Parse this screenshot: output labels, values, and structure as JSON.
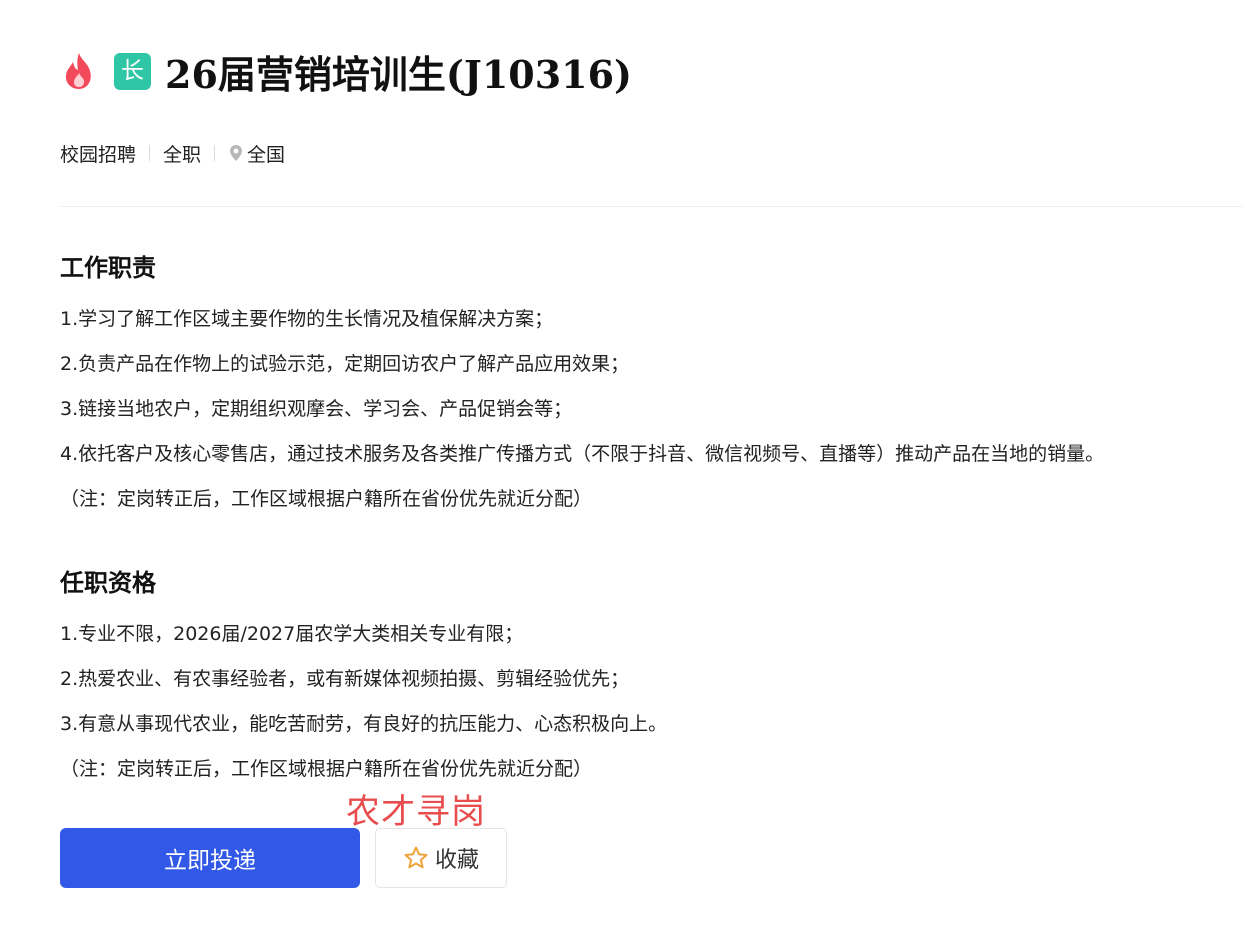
{
  "header": {
    "hot_icon": "fire-icon",
    "badge_text": "长",
    "badge_color": "#2ec6a4",
    "title": "26届营销培训生(J10316)"
  },
  "meta": {
    "recruit_type": "校园招聘",
    "job_type": "全职",
    "location_icon": "map-pin-icon",
    "location": "全国"
  },
  "duties": {
    "title": "工作职责",
    "lines": [
      "1.学习了解工作区域主要作物的生长情况及植保解决方案；",
      "2.负责产品在作物上的试验示范，定期回访农户了解产品应用效果；",
      "3.链接当地农户，定期组织观摩会、学习会、产品促销会等；",
      "4.依托客户及核心零售店，通过技术服务及各类推广传播方式（不限于抖音、微信视频号、直播等）推动产品在当地的销量。",
      "（注：定岗转正后，工作区域根据户籍所在省份优先就近分配）"
    ]
  },
  "requirements": {
    "title": "任职资格",
    "lines": [
      "1.专业不限，2026届/2027届农学大类相关专业有限；",
      "2.热爱农业、有农事经验者，或有新媒体视频拍摄、剪辑经验优先；",
      "3.有意从事现代农业，能吃苦耐劳，有良好的抗压能力、心态积极向上。",
      "（注：定岗转正后，工作区域根据户籍所在省份优先就近分配）"
    ]
  },
  "watermark": "农才寻岗",
  "actions": {
    "apply_label": "立即投递",
    "favorite_label": "收藏",
    "favorite_icon": "star-icon",
    "apply_color": "#3158e6"
  }
}
